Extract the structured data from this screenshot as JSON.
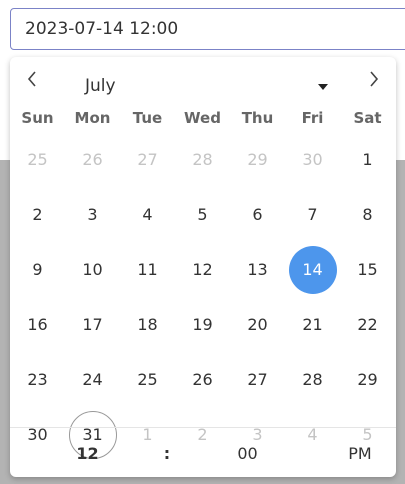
{
  "input": {
    "value": "2023-07-14 12:00"
  },
  "picker": {
    "month": "July",
    "weekdays": [
      "Sun",
      "Mon",
      "Tue",
      "Wed",
      "Thu",
      "Fri",
      "Sat"
    ],
    "weeks": [
      [
        "25",
        "26",
        "27",
        "28",
        "29",
        "30",
        "1"
      ],
      [
        "2",
        "3",
        "4",
        "5",
        "6",
        "7",
        "8"
      ],
      [
        "9",
        "10",
        "11",
        "12",
        "13",
        "14",
        "15"
      ],
      [
        "16",
        "17",
        "18",
        "19",
        "20",
        "21",
        "22"
      ],
      [
        "23",
        "24",
        "25",
        "26",
        "27",
        "28",
        "29"
      ],
      [
        "30",
        "31",
        "1",
        "2",
        "3",
        "4",
        "5"
      ]
    ],
    "selected_day": "14",
    "today_day": "31",
    "time": {
      "hour": "12",
      "separator": ":",
      "minute": "00",
      "ampm": "PM"
    }
  },
  "colors": {
    "selected": "#4d96ec",
    "input_border": "#7b83c7",
    "outside_month": "#c4c4c4"
  },
  "icons": {
    "prev": "chevron-left-icon",
    "next": "chevron-right-icon",
    "dropdown": "caret-down-icon"
  }
}
